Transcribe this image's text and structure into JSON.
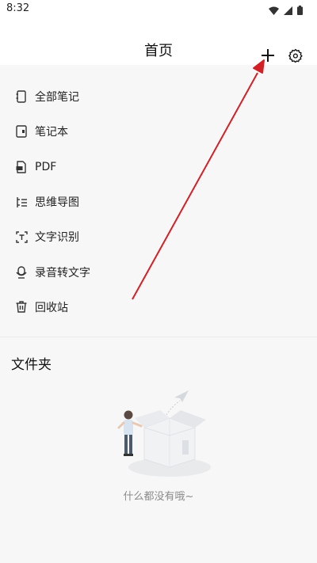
{
  "status_bar": {
    "time": "8:32",
    "icons": [
      "wifi-icon",
      "signal-icon",
      "battery-icon"
    ]
  },
  "header": {
    "title": "首页",
    "actions": [
      "plus-icon",
      "gear-icon"
    ]
  },
  "menu": {
    "items": [
      {
        "label": "全部笔记",
        "icon": "notebook-icon"
      },
      {
        "label": "笔记本",
        "icon": "book-icon"
      },
      {
        "label": "PDF",
        "icon": "pdf-icon"
      },
      {
        "label": "思维导图",
        "icon": "mindmap-icon"
      },
      {
        "label": "文字识别",
        "icon": "scan-text-icon"
      },
      {
        "label": "录音转文字",
        "icon": "microphone-icon"
      },
      {
        "label": "回收站",
        "icon": "trash-icon"
      }
    ]
  },
  "folders": {
    "title": "文件夹",
    "empty_text": "什么都没有哦~"
  },
  "colors": {
    "background": "#f7f7f7",
    "surface": "#ffffff",
    "annotation_arrow": "#d32027",
    "muted_text": "#8a8a8a"
  }
}
